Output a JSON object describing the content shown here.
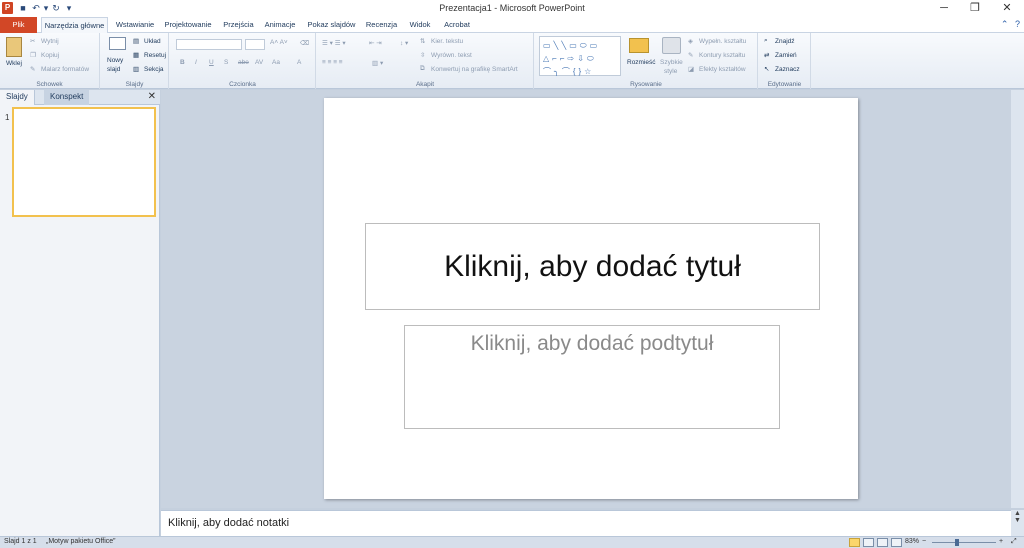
{
  "window": {
    "title": "Prezentacja1 - Microsoft PowerPoint",
    "app_letter": "P",
    "minimize": "─",
    "restore": "❐",
    "close": "✕"
  },
  "tabs": [
    {
      "label": "Plik"
    },
    {
      "label": "Narzędzia główne"
    },
    {
      "label": "Wstawianie"
    },
    {
      "label": "Projektowanie"
    },
    {
      "label": "Przejścia"
    },
    {
      "label": "Animacje"
    },
    {
      "label": "Pokaz slajdów"
    },
    {
      "label": "Recenzja"
    },
    {
      "label": "Widok"
    },
    {
      "label": "Acrobat"
    }
  ],
  "ribbon": {
    "clipboard": {
      "label": "Schowek",
      "paste": "Wklej",
      "cut": "Wytnij",
      "copy": "Kopiuj",
      "format_painter": "Malarz formatów"
    },
    "slides": {
      "label": "Slajdy",
      "new_slide_1": "Nowy",
      "new_slide_2": "slajd",
      "layout": "Układ",
      "reset": "Resetuj",
      "section": "Sekcja"
    },
    "font": {
      "label": "Czcionka",
      "bold": "B",
      "italic": "I",
      "underline": "U",
      "strike": "S",
      "shadow": "abe",
      "spacing": "AV",
      "case": "Aa",
      "color": "A"
    },
    "paragraph": {
      "label": "Akapit",
      "text_direction": "Kier. tekstu",
      "align_text": "Wyrówn. tekst",
      "smartart": "Konwertuj na grafikę SmartArt"
    },
    "drawing": {
      "label": "Rysowanie",
      "arrange": "Rozmieść",
      "quick_styles_1": "Szybkie",
      "quick_styles_2": "style",
      "shape_fill": "Wypełn. kształtu",
      "shape_outline": "Kontury kształtu",
      "shape_effects": "Efekty kształtów"
    },
    "editing": {
      "label": "Edytowanie",
      "find": "Znajdź",
      "replace": "Zamień",
      "select": "Zaznacz"
    }
  },
  "left_panel": {
    "tab_slides": "Slajdy",
    "tab_outline": "Konspekt",
    "close": "✕",
    "slide_number": "1"
  },
  "slide": {
    "title_placeholder": "Kliknij, aby dodać tytuł",
    "subtitle_placeholder": "Kliknij, aby dodać podtytuł"
  },
  "notes": {
    "placeholder": "Kliknij, aby dodać notatki"
  },
  "status": {
    "slide_info": "Slajd 1 z 1",
    "theme": "„Motyw pakietu Office”",
    "zoom": "83%",
    "zoom_out": "−",
    "zoom_in": "+"
  },
  "colors": {
    "file_tab": "#d24726",
    "selected_thumbnail_border": "#f2c14e"
  }
}
